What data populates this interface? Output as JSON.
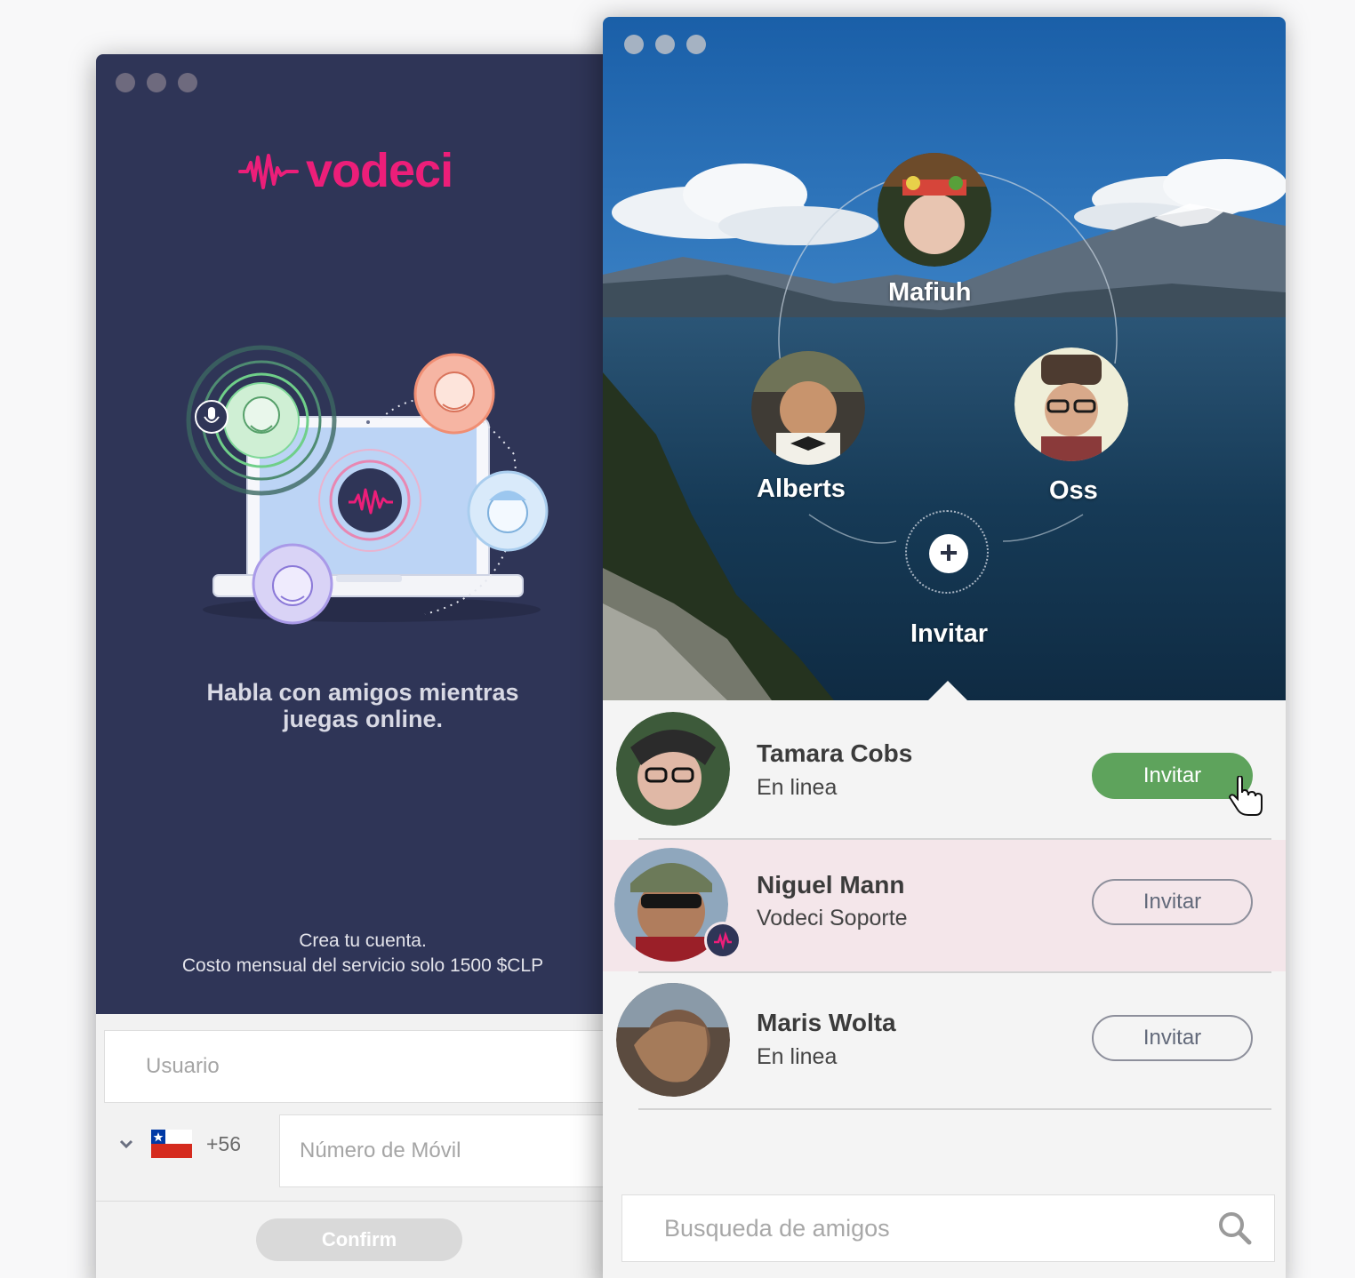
{
  "signup_window": {
    "brand": {
      "name": "vodeci",
      "color": "#ec1e79"
    },
    "tagline": "Habla con amigos mientras juegas online.",
    "pricing": {
      "line1": "Crea tu cuenta.",
      "line2": "Costo mensual del servicio solo 1500 $CLP"
    },
    "username_placeholder": "Usuario",
    "country": {
      "flag_icon": "chile-flag-icon",
      "dial_code": "+56"
    },
    "phone_placeholder": "Número de Móvil",
    "confirm_label": "Confirm"
  },
  "friends_window": {
    "circle": [
      {
        "name": "Mafiuh"
      },
      {
        "name": "Alberts"
      },
      {
        "name": "Oss"
      }
    ],
    "invite_label": "Invitar",
    "friends": [
      {
        "name": "Tamara Cobs",
        "status": "En linea",
        "button": "Invitar",
        "style": "solid"
      },
      {
        "name": "Niguel Mann",
        "status": "Vodeci Soporte",
        "button": "Invitar",
        "style": "outline",
        "highlighted": true
      },
      {
        "name": "Maris Wolta",
        "status": "En linea",
        "button": "Invitar",
        "style": "outline"
      }
    ],
    "search_placeholder": "Busqueda de amigos"
  },
  "colors": {
    "left_bg": "#2f3557",
    "accent_green": "#5ea35c",
    "highlight_row": "#f4e6ea"
  }
}
